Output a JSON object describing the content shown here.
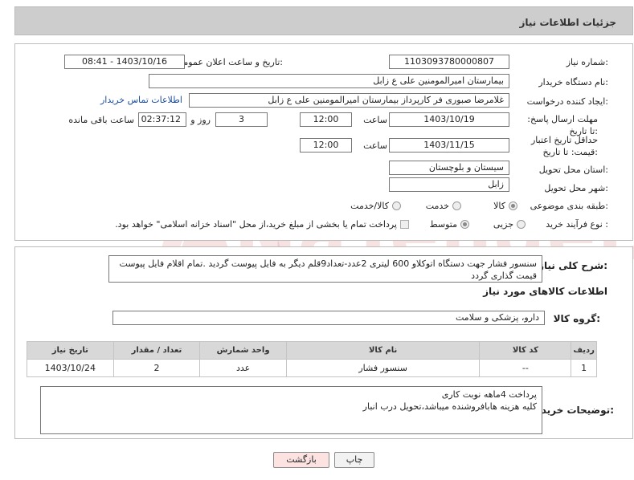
{
  "header": {
    "title": "جزئیات اطلاعات نیاز"
  },
  "form": {
    "need_number_label": "شماره نیاز:",
    "need_number": "1103093780000807",
    "announce_label": "تاریخ و ساعت اعلان عمومی:",
    "announce_value": "1403/10/16 - 08:41",
    "buyer_org_label": "نام دستگاه خریدار:",
    "buyer_org": "بیمارستان امیرالمومنین علی  ع  زابل",
    "creator_label": "ایجاد کننده درخواست:",
    "creator": "غلامرضا صبوری فر کارپرداز بیمارستان امیرالمومنین علی  ع  زابل",
    "contact_link": "اطلاعات تماس خریدار",
    "deadline_label": "مهلت ارسال پاسخ: تا تاریخ:",
    "deadline_date": "1403/10/19",
    "time_label": "ساعت",
    "deadline_time": "12:00",
    "days_value": "3",
    "days_label": "روز و",
    "remaining_time": "02:37:12",
    "remaining_label": "ساعت باقی مانده",
    "price_validity_label": "حداقل تاریخ اعتبار قیمت: تا تاریخ:",
    "price_validity_date": "1403/11/15",
    "price_validity_time": "12:00",
    "province_label": "استان محل تحویل:",
    "province": "سیستان و بلوچستان",
    "city_label": "شهر محل تحویل:",
    "city": "زابل",
    "category_label": "طبقه بندی موضوعی:",
    "category_options": [
      "کالا",
      "خدمت",
      "کالا/خدمت"
    ],
    "process_label": "نوع فرآیند خرید :",
    "process_options": [
      "جزیی",
      "متوسط"
    ],
    "payment_note": "پرداخت تمام یا بخشی از مبلغ خرید،از محل \"اسناد خزانه اسلامی\" خواهد بود."
  },
  "description": {
    "label": "شرح کلی نیاز:",
    "text": "سنسور فشار جهت دستگاه اتوکلاو  600 لیتری  2عدد-تعداد9قلم دیگر به فایل پیوست گردید .تمام اقلام فایل پیوست قیمت گذاری گردد"
  },
  "goods": {
    "section_title": "اطلاعات کالاهای مورد نیاز",
    "group_label": "گروه کالا:",
    "group_value": "دارو، پزشکی و سلامت",
    "columns": [
      "ردیف",
      "کد کالا",
      "نام کالا",
      "واحد شمارش",
      "تعداد / مقدار",
      "تاریخ نیاز"
    ],
    "rows": [
      [
        "1",
        "--",
        "سنسور فشار",
        "عدد",
        "2",
        "1403/10/24"
      ]
    ]
  },
  "buyer_notes": {
    "label": "توضیحات خریدار:",
    "line1": "پرداخت 4ماهه نوبت کاری",
    "line2": "کلیه هزینه هابافروشنده میباشد،تحویل درب انبار"
  },
  "buttons": {
    "print": "چاپ",
    "back": "بازگشت"
  },
  "watermark": "AriaTender.neT",
  "colors": {
    "link": "#1a4c9c",
    "back_button_bg": "#fde2e2",
    "watermark": "#c62828"
  }
}
